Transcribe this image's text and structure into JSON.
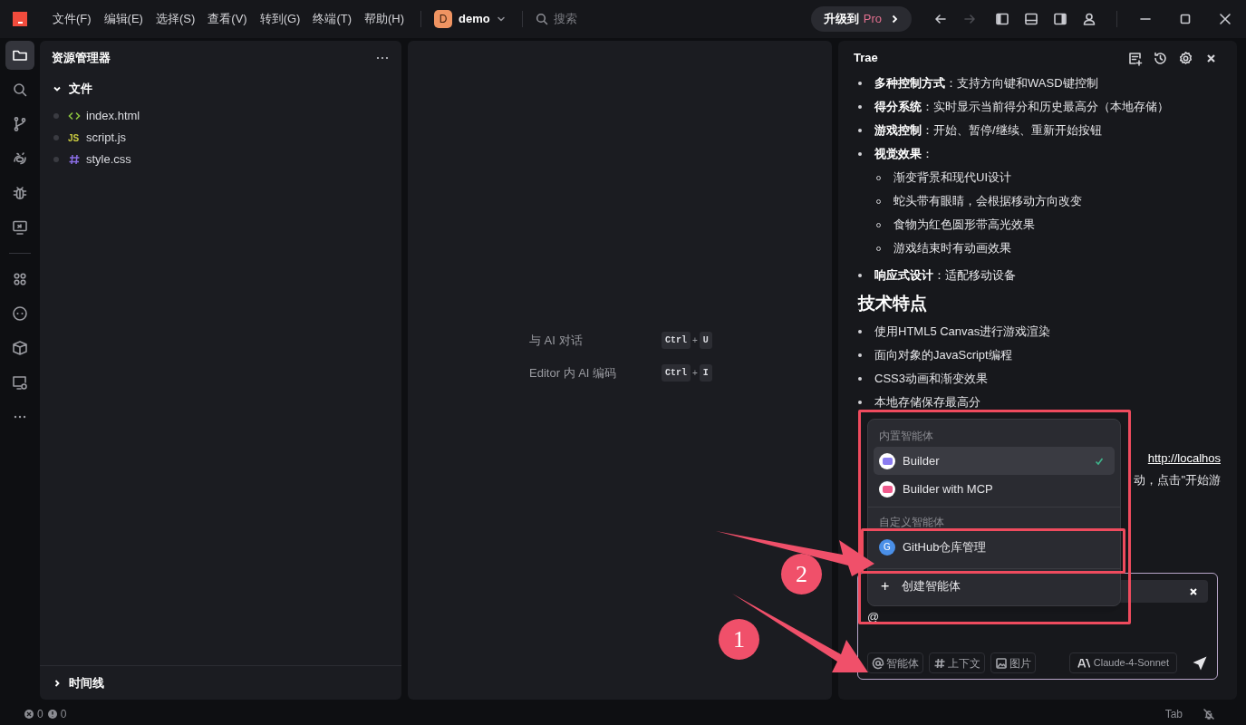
{
  "titlebar": {
    "menus": [
      "文件(F)",
      "编辑(E)",
      "选择(S)",
      "查看(V)",
      "转到(G)",
      "终端(T)",
      "帮助(H)"
    ],
    "project": {
      "initial": "D",
      "name": "demo"
    },
    "search": {
      "placeholder": "搜索"
    },
    "upgrade": {
      "label": "升级到",
      "badge": "Pro"
    },
    "history": [
      {
        "kind": "back",
        "disabled": false
      },
      {
        "kind": "forward",
        "disabled": true
      }
    ]
  },
  "activity_bar": [
    {
      "kind": "files",
      "selected": true
    },
    {
      "kind": "search",
      "selected": false
    },
    {
      "kind": "branch",
      "selected": false
    },
    {
      "kind": "eye",
      "selected": false
    },
    {
      "kind": "bug",
      "selected": false
    },
    {
      "kind": "remote",
      "selected": false
    },
    {
      "kind": "divider"
    },
    {
      "kind": "apps",
      "selected": false
    },
    {
      "kind": "bot",
      "selected": false
    },
    {
      "kind": "box",
      "selected": false
    },
    {
      "kind": "monitor",
      "selected": false
    },
    {
      "kind": "more",
      "selected": false
    }
  ],
  "explorer": {
    "title": "资源管理器",
    "section": {
      "label": "文件",
      "expanded": true,
      "files": [
        {
          "name": "index.html",
          "kind": "html"
        },
        {
          "name": "script.js",
          "kind": "js",
          "icon_text": "JS"
        },
        {
          "name": "style.css",
          "kind": "css"
        }
      ]
    },
    "timeline": {
      "label": "时间线",
      "expanded": false
    }
  },
  "editor": {
    "shortcuts": [
      {
        "label": "与 AI 对话",
        "keys": [
          "Ctrl",
          "U"
        ],
        "joiner": "+"
      },
      {
        "label": "Editor 内 AI 编码",
        "keys": [
          "Ctrl",
          "I"
        ],
        "joiner": "+"
      }
    ]
  },
  "chat": {
    "title": "Trae",
    "content": [
      {
        "kind": "bullet",
        "text": "**多种控制方式**：支持方向键和WASD键控制"
      },
      {
        "kind": "bullet",
        "text": "**得分系统**：实时显示当前得分和历史最高分（本地存储）"
      },
      {
        "kind": "bullet",
        "text": "**游戏控制**：开始、暂停/继续、重新开始按钮"
      },
      {
        "kind": "bullet",
        "text": "**视觉效果**：",
        "children": [
          {
            "kind": "bullet",
            "text": "渐变背景和现代UI设计"
          },
          {
            "kind": "bullet",
            "text": "蛇头带有眼睛，会根据移动方向改变"
          },
          {
            "kind": "bullet",
            "text": "食物为红色圆形带高光效果"
          },
          {
            "kind": "bullet",
            "text": "游戏结束时有动画效果"
          }
        ]
      },
      {
        "kind": "bullet",
        "text": "**响应式设计**：适配移动设备"
      },
      {
        "kind": "heading",
        "text": "技术特点"
      },
      {
        "kind": "bullet",
        "text": "使用HTML5 Canvas进行游戏渲染"
      },
      {
        "kind": "bullet",
        "text": "面向对象的JavaScript编程"
      },
      {
        "kind": "bullet",
        "text": "CSS3动画和渐变效果"
      },
      {
        "kind": "bullet",
        "text": "本地存储保存最高分"
      }
    ],
    "fragments": [
      {
        "link": "http://localhos"
      },
      {
        "text": "动，点击\"开始游"
      }
    ],
    "agent_menu": {
      "sections": [
        {
          "label": "内置智能体",
          "items": [
            {
              "label": "Builder",
              "kind": "builder",
              "selected": true
            },
            {
              "label": "Builder with MCP",
              "kind": "mcp",
              "selected": false
            }
          ]
        },
        {
          "label": "自定义智能体",
          "items": [
            {
              "label": "GitHub仓库管理",
              "kind": "custom",
              "initial": "G",
              "selected": false
            }
          ]
        }
      ],
      "create": {
        "icon": "+",
        "label": "创建智能体"
      }
    },
    "input": {
      "value": "@",
      "chips": [
        {
          "kind": "at",
          "label": "智能体"
        },
        {
          "kind": "hash",
          "label": "上下文"
        },
        {
          "kind": "image",
          "label": "图片"
        }
      ],
      "model": "Claude-4-Sonnet"
    }
  },
  "annotations": [
    {
      "label": "1"
    },
    {
      "label": "2"
    }
  ],
  "status_bar": {
    "errors": "0",
    "warnings": "0",
    "mode": "Tab"
  }
}
